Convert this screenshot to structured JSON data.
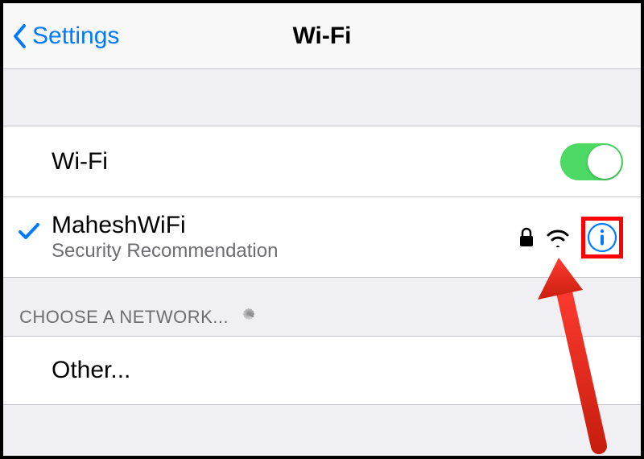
{
  "nav": {
    "back_label": "Settings",
    "title": "Wi-Fi"
  },
  "wifi_toggle": {
    "label": "Wi-Fi",
    "on": true
  },
  "connected_network": {
    "name": "MaheshWiFi",
    "subtitle": "Security Recommendation"
  },
  "section_header": "CHOOSE A NETWORK...",
  "other_label": "Other..."
}
